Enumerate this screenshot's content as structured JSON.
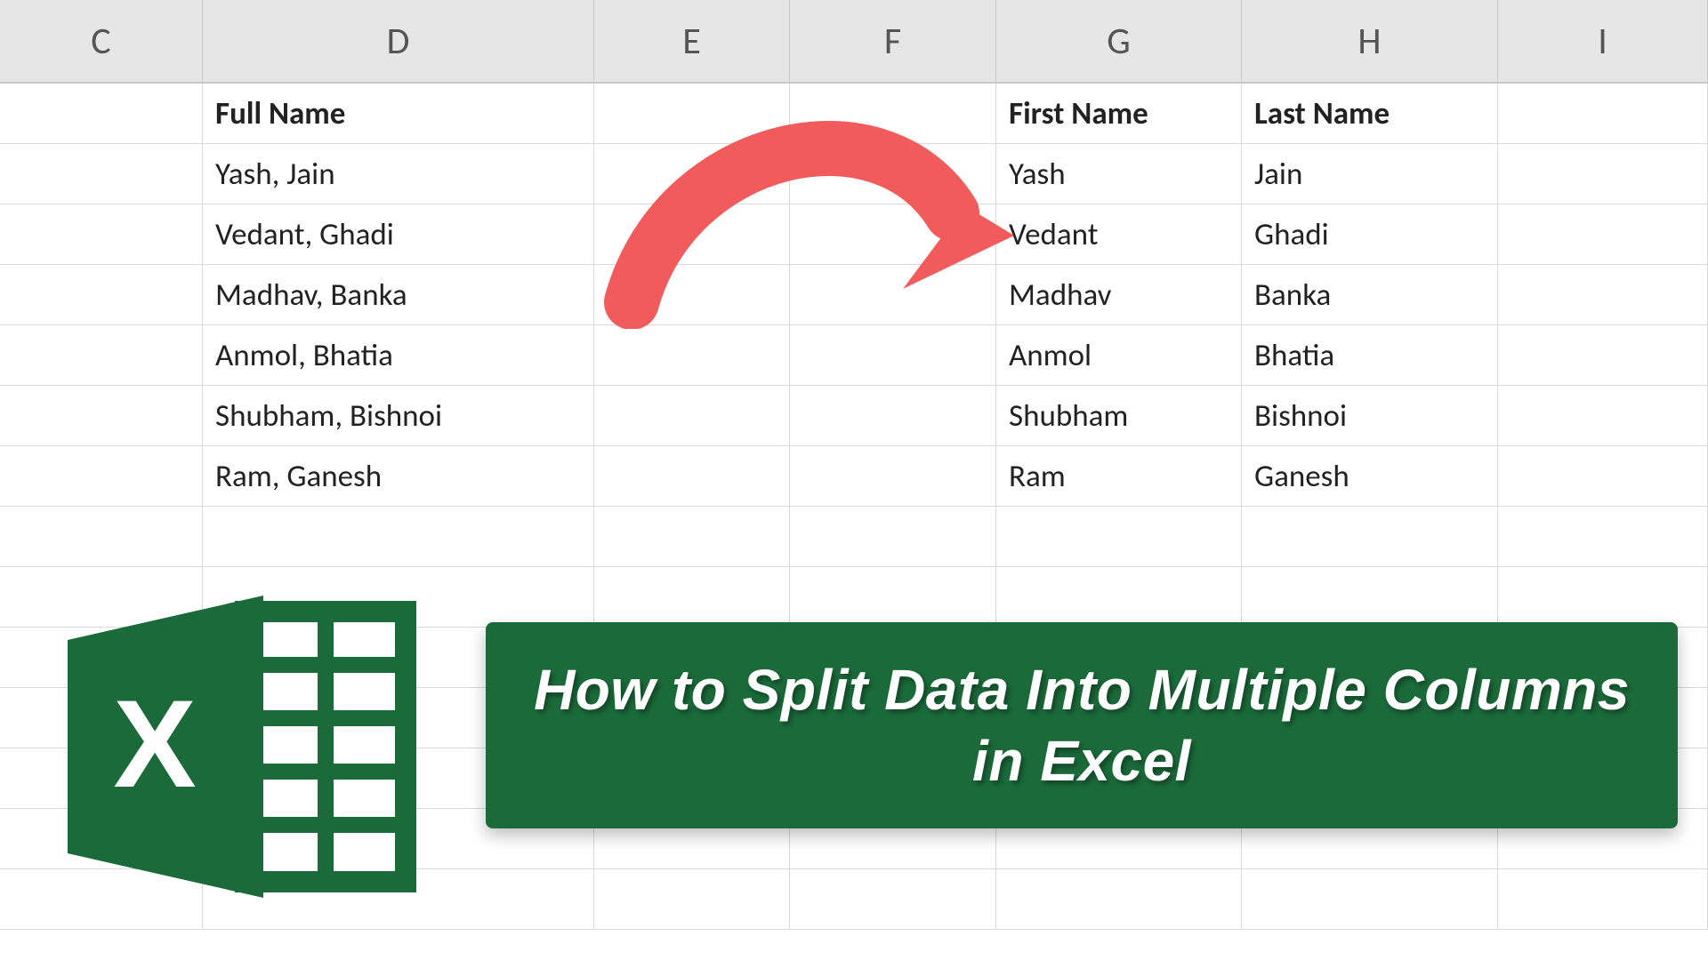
{
  "columns": [
    "C",
    "D",
    "E",
    "F",
    "G",
    "H",
    "I"
  ],
  "headers": {
    "full_name": "Full Name",
    "first_name": "First Name",
    "last_name": "Last Name"
  },
  "data": {
    "full_names": [
      "Yash, Jain",
      "Vedant, Ghadi",
      "Madhav, Banka",
      "Anmol, Bhatia",
      "Shubham, Bishnoi",
      "Ram, Ganesh"
    ],
    "first_names": [
      "Yash",
      "Vedant",
      "Madhav",
      "Anmol",
      "Shubham",
      "Ram"
    ],
    "last_names": [
      "Jain",
      "Ghadi",
      "Banka",
      "Bhatia",
      "Bishnoi",
      "Ganesh"
    ]
  },
  "banner": {
    "title": "How to Split Data Into Multiple Columns in Excel"
  },
  "icon": {
    "name": "excel-icon"
  },
  "colors": {
    "arrow": "#f15b5b",
    "banner_bg": "#1b6b3a",
    "excel_green": "#1b6b3a"
  }
}
